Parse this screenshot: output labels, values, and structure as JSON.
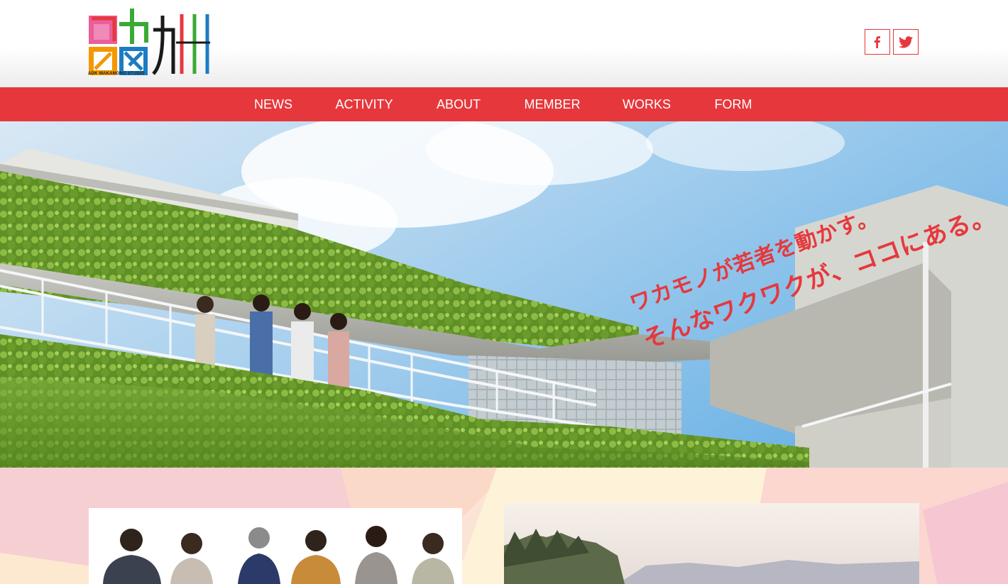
{
  "header": {
    "logo_caption": "ADK WAKAMONO STUDIO",
    "logo_alt": "ワカモノ九州 logo",
    "social": [
      {
        "name": "facebook",
        "icon": "facebook-icon"
      },
      {
        "name": "twitter",
        "icon": "twitter-icon"
      }
    ]
  },
  "nav": {
    "items": [
      {
        "label": "NEWS"
      },
      {
        "label": "ACTIVITY"
      },
      {
        "label": "ABOUT"
      },
      {
        "label": "MEMBER"
      },
      {
        "label": "WORKS"
      },
      {
        "label": "FORM"
      }
    ]
  },
  "hero": {
    "tagline_line1": "ワカモノが若者を動かす。",
    "tagline_line2": "そんなワクワクが、ココにある。"
  },
  "colors": {
    "brand_red": "#e6383c",
    "nav_text": "#ffffff"
  }
}
